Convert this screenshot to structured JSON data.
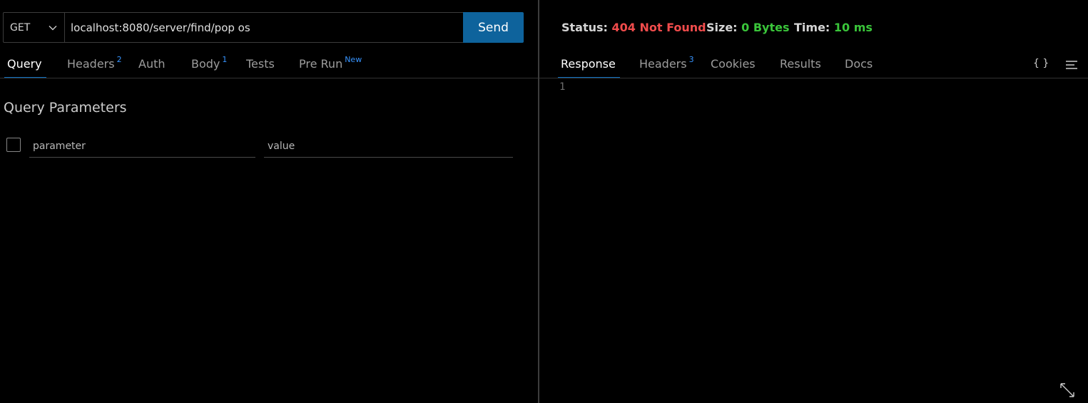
{
  "request": {
    "method": "GET",
    "url": "localhost:8080/server/find/pop os",
    "send_label": "Send"
  },
  "request_tabs": [
    {
      "label": "Query",
      "badge": ""
    },
    {
      "label": "Headers",
      "badge": "2"
    },
    {
      "label": "Auth",
      "badge": ""
    },
    {
      "label": "Body",
      "badge": "1"
    },
    {
      "label": "Tests",
      "badge": ""
    },
    {
      "label": "Pre Run",
      "badge": "New"
    }
  ],
  "query": {
    "title": "Query Parameters",
    "param_placeholder": "parameter",
    "value_placeholder": "value"
  },
  "response": {
    "status_label": "Status:",
    "status_value": "404 Not Found",
    "size_label": "Size:",
    "size_value": "0 Bytes",
    "time_label": "Time:",
    "time_value": "10 ms",
    "line_number": "1"
  },
  "response_tabs": [
    {
      "label": "Response",
      "badge": ""
    },
    {
      "label": "Headers",
      "badge": "3"
    },
    {
      "label": "Cookies",
      "badge": ""
    },
    {
      "label": "Results",
      "badge": ""
    },
    {
      "label": "Docs",
      "badge": ""
    }
  ],
  "icons": {
    "format": "{ }",
    "menu": "lines-icon",
    "expand": "expand-icon",
    "chevron": "chevron-down-icon"
  },
  "colors": {
    "accent": "#0e639c",
    "error": "#f14c4c",
    "success": "#3ac53a",
    "badge": "#3794ff"
  }
}
